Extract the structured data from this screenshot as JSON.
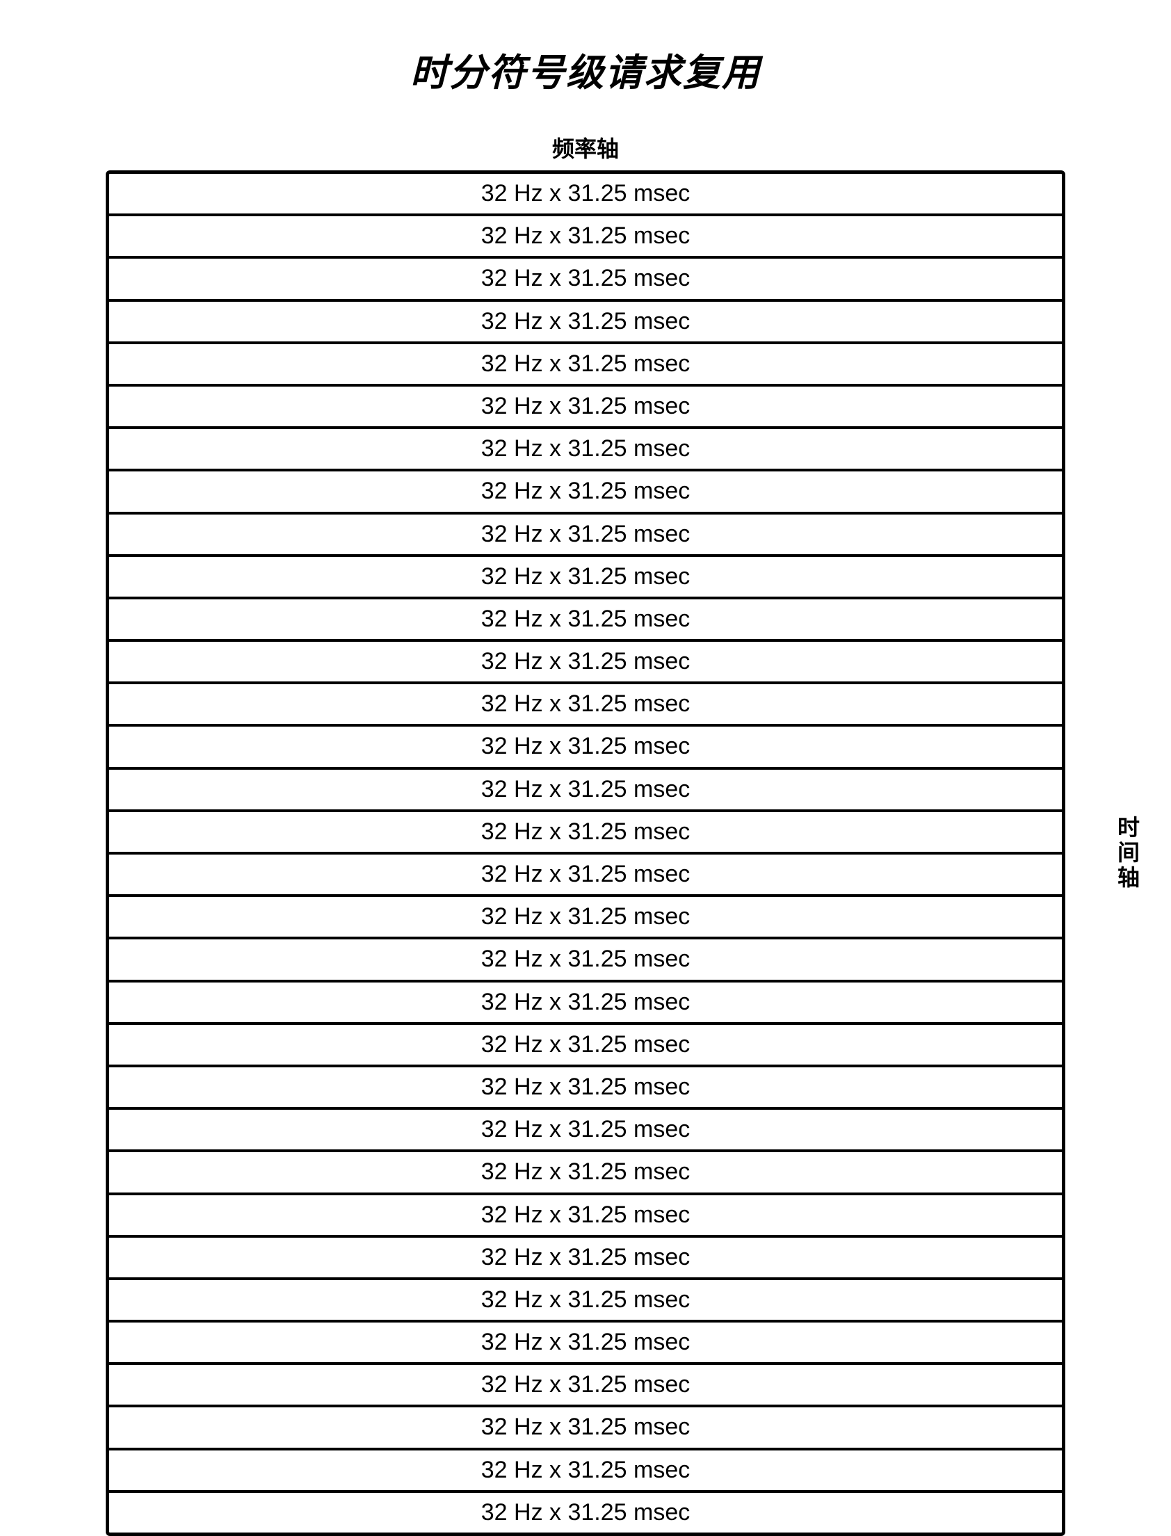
{
  "title": "时分符号级请求复用",
  "freq_axis_label": "频率轴",
  "time_axis_label": "时间轴",
  "cell_text": "32 Hz x 31.25 msec",
  "rows": [
    "32 Hz x 31.25 msec",
    "32 Hz x 31.25 msec",
    "32 Hz x 31.25 msec",
    "32 Hz x 31.25 msec",
    "32 Hz x 31.25 msec",
    "32 Hz x 31.25 msec",
    "32 Hz x 31.25 msec",
    "32 Hz x 31.25 msec",
    "32 Hz x 31.25 msec",
    "32 Hz x 31.25 msec",
    "32 Hz x 31.25 msec",
    "32 Hz x 31.25 msec",
    "32 Hz x 31.25 msec",
    "32 Hz x 31.25 msec",
    "32 Hz x 31.25 msec",
    "32 Hz x 31.25 msec",
    "32 Hz x 31.25 msec",
    "32 Hz x 31.25 msec",
    "32 Hz x 31.25 msec",
    "32 Hz x 31.25 msec",
    "32 Hz x 31.25 msec",
    "32 Hz x 31.25 msec",
    "32 Hz x 31.25 msec",
    "32 Hz x 31.25 msec",
    "32 Hz x 31.25 msec",
    "32 Hz x 31.25 msec",
    "32 Hz x 31.25 msec",
    "32 Hz x 31.25 msec",
    "32 Hz x 31.25 msec",
    "32 Hz x 31.25 msec",
    "32 Hz x 31.25 msec",
    "32 Hz x 31.25 msec"
  ]
}
